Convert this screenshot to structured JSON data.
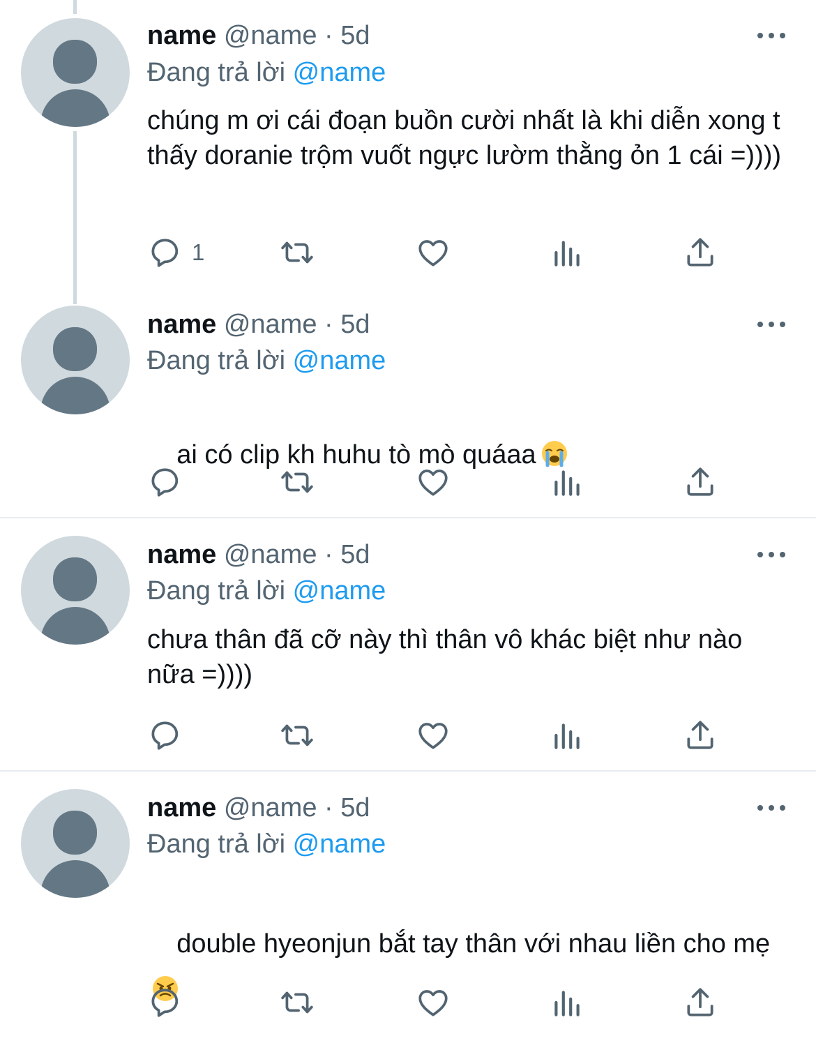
{
  "colors": {
    "text": "#0f1419",
    "secondary": "#536471",
    "link": "#1d9bf0",
    "avatar_bg": "#cfd9de",
    "avatar_fg": "#647785",
    "divider": "#e7ecf0"
  },
  "reply_label": "Đang trả lời",
  "tweets": [
    {
      "display_name": "name",
      "handle": "@name",
      "separator": "·",
      "time": "5d",
      "reply_to": "@name",
      "text": "chúng m ơi cái đoạn buồn cười nhất là khi diễn xong t thấy doranie trộm vuốt ngực lườm thằng ỏn 1 cái =))))",
      "reply_count": "1"
    },
    {
      "display_name": "name",
      "handle": "@name",
      "separator": "·",
      "time": "5d",
      "reply_to": "@name",
      "text": "ai có clip kh huhu tò mò quáaa",
      "emoji": "loudly-crying-face-emoji",
      "reply_count": ""
    },
    {
      "display_name": "name",
      "handle": "@name",
      "separator": "·",
      "time": "5d",
      "reply_to": "@name",
      "text": "chưa thân đã cỡ này thì thân vô khác biệt như nào nữa =))))",
      "reply_count": ""
    },
    {
      "display_name": "name",
      "handle": "@name",
      "separator": "·",
      "time": "5d",
      "reply_to": "@name",
      "text": "double hyeonjun bắt tay thân với nhau liền cho mẹ",
      "emoji": "angry-face-emoji",
      "reply_count": ""
    }
  ],
  "icons": [
    "reply-icon",
    "retweet-icon",
    "like-icon",
    "analytics-icon",
    "share-icon",
    "more-icon"
  ]
}
